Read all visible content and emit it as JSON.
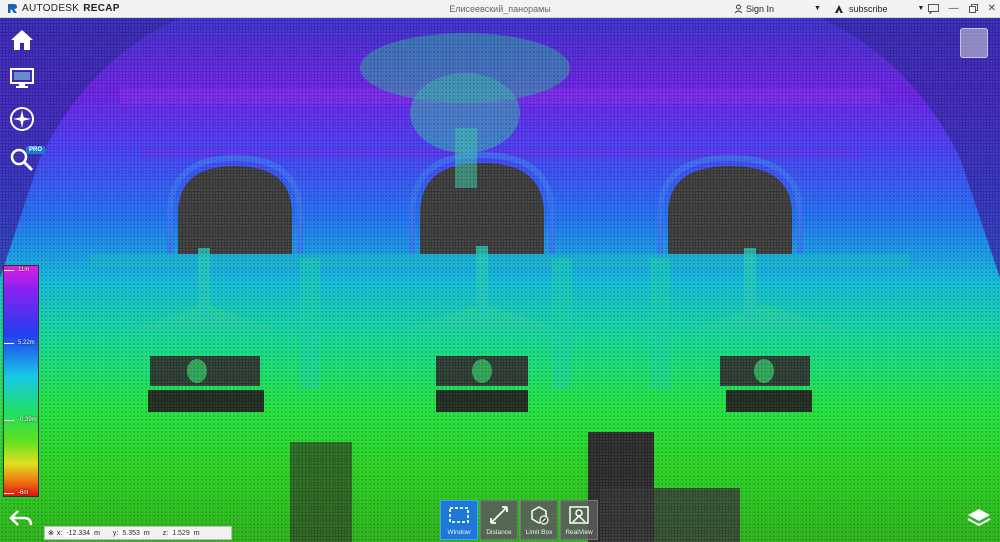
{
  "titlebar": {
    "brand_light": "AUTODESK",
    "brand_bold": "RECAP",
    "document_title": "Елисеевский_панорамы",
    "signin_label": "Sign In",
    "subscribe_label": "subscribe"
  },
  "left_tools": {
    "pro_badge": "PRO"
  },
  "color_scale": {
    "labels": [
      "11m",
      "5.22m",
      "-0.39m",
      "-6m"
    ],
    "stops": [
      "#e020e0",
      "#8a20f0",
      "#2040f0",
      "#18c8e8",
      "#20e060",
      "#60e020",
      "#e0e020",
      "#f07010",
      "#e01010"
    ]
  },
  "coordinates": {
    "x_label": "x:",
    "x_value": "-12.334",
    "x_unit": "m",
    "y_label": "y:",
    "y_value": "5.353",
    "y_unit": "m",
    "z_label": "z:",
    "z_value": "1.529",
    "z_unit": "m"
  },
  "bottom_toolbar": {
    "tools": [
      {
        "label": "Window",
        "active": true
      },
      {
        "label": "Distance",
        "active": false
      },
      {
        "label": "Limit Box",
        "active": false
      },
      {
        "label": "RealView",
        "active": false
      }
    ]
  },
  "colors": {
    "accent": "#1e78d8",
    "titlebar_bg": "#f3f3f3"
  }
}
